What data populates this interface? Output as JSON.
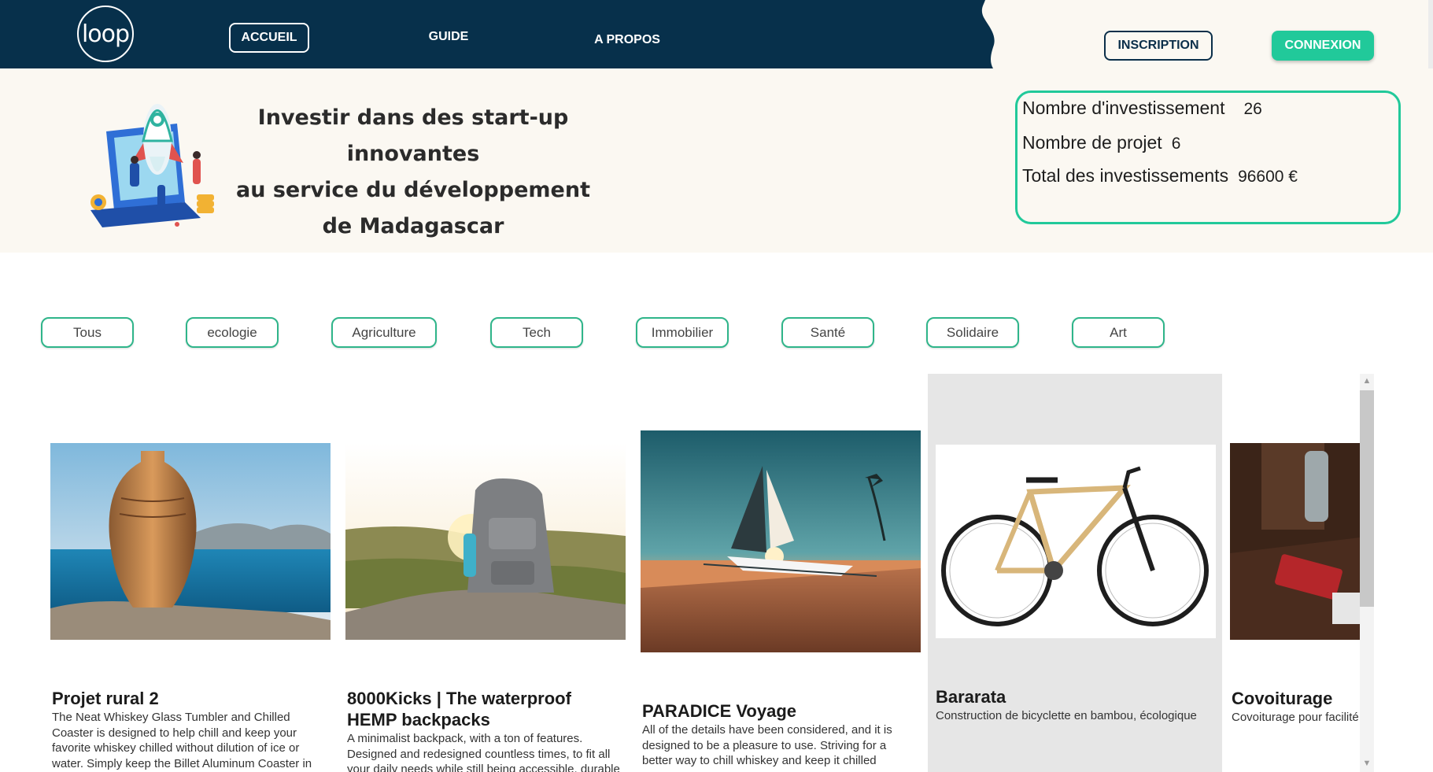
{
  "header": {
    "logo_text": "loop",
    "nav": {
      "accueil": "ACCUEIL",
      "guide": "GUIDE",
      "apropos": "A PROPOS"
    },
    "inscription": "INSCRIPTION",
    "connexion": "CONNEXION",
    "colors": {
      "bar": "#07304b",
      "accent": "#21c99a"
    }
  },
  "hero": {
    "title_line1": "Investir dans des start-up innovantes",
    "title_line2": "au service du développement",
    "title_line3": "de Madagascar",
    "illustration": "rocket-laptop-illustration"
  },
  "stats": {
    "investments_label": "Nombre d'investissement",
    "investments_value": "26",
    "projects_label": "Nombre de projet",
    "projects_value": "6",
    "total_label": "Total des investissements",
    "total_value": "96600 €"
  },
  "filters": [
    "Tous",
    "ecologie",
    "Agriculture",
    "Tech",
    "Immobilier",
    "Santé",
    "Solidaire",
    "Art"
  ],
  "cards": [
    {
      "title": "Projet rural 2",
      "description": "The Neat Whiskey Glass Tumbler and Chilled Coaster is designed to help chill and keep your favorite whiskey chilled without dilution of ice or water. Simply keep the Billet Aluminum Coaster in"
    },
    {
      "title": "8000Kicks | The waterproof HEMP backpacks",
      "description": "A minimalist backpack, with a ton of features. Designed and redesigned countless times, to fit all your daily needs while still being accessible, durable"
    },
    {
      "title": "PARADICE Voyage",
      "description": "All of the details have been considered, and it is designed to be a pleasure to use. Striving for a better way to chill whiskey and keep it chilled"
    },
    {
      "title": "Bararata",
      "description": "Construction de bicyclette en bambou, écologique"
    },
    {
      "title": "Covoiturage",
      "description": "Covoiturage pour facilité"
    }
  ]
}
